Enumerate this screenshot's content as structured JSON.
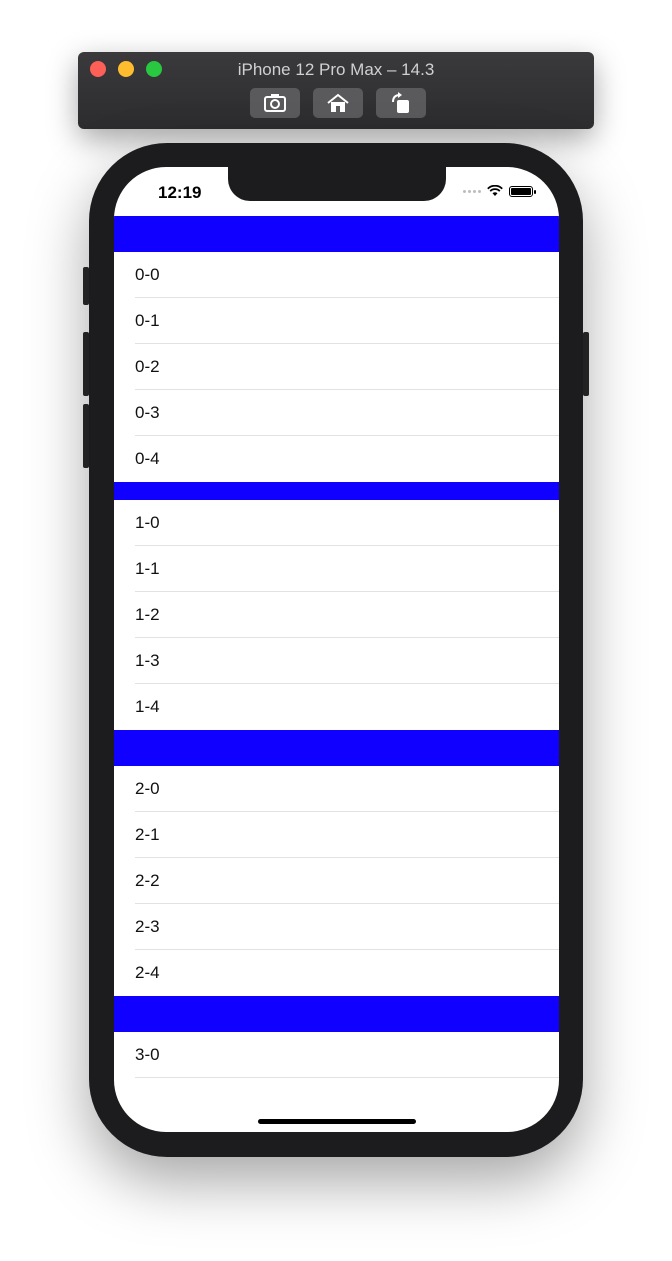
{
  "simulator": {
    "title": "iPhone 12 Pro Max – 14.3",
    "toolbar_buttons": [
      {
        "name": "screenshot",
        "icon": "camera-icon"
      },
      {
        "name": "home",
        "icon": "home-icon"
      },
      {
        "name": "rotate",
        "icon": "rotate-icon"
      }
    ]
  },
  "status_bar": {
    "time": "12:19"
  },
  "colors": {
    "section_header": "#0f00ff"
  },
  "sections": [
    {
      "rows": [
        "0-0",
        "0-1",
        "0-2",
        "0-3",
        "0-4"
      ]
    },
    {
      "rows": [
        "1-0",
        "1-1",
        "1-2",
        "1-3",
        "1-4"
      ]
    },
    {
      "rows": [
        "2-0",
        "2-1",
        "2-2",
        "2-3",
        "2-4"
      ]
    },
    {
      "rows": [
        "3-0"
      ]
    }
  ]
}
